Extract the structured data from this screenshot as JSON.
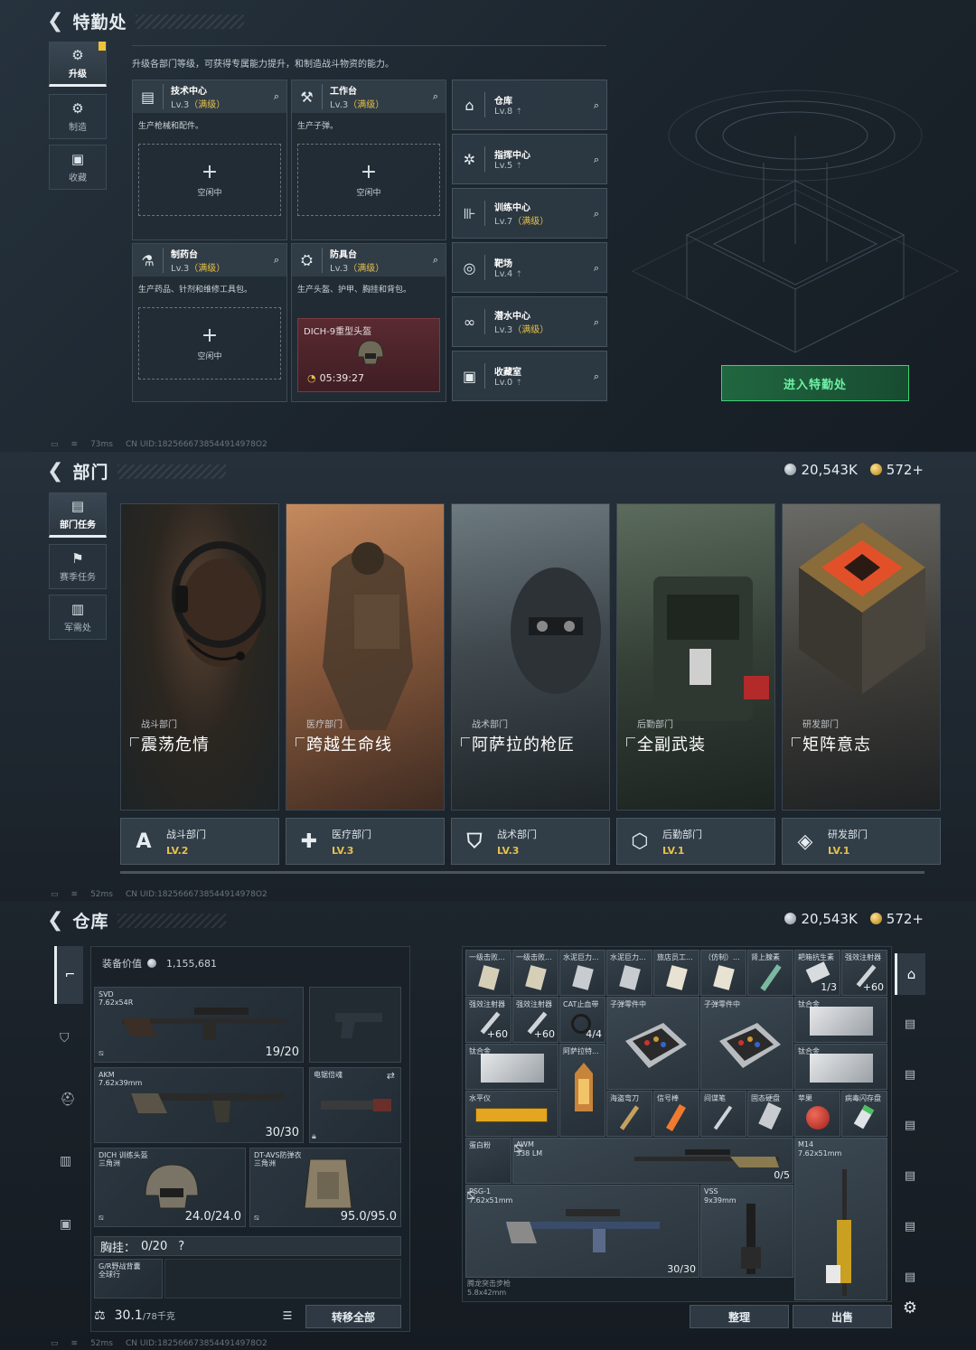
{
  "s1": {
    "title": "特勤处",
    "subtitle": "升级各部门等级，可获得专属能力提升，和制造战斗物资的能力。",
    "tabs": [
      {
        "label": "升级",
        "icon": "upgrade-icon"
      },
      {
        "label": "制造",
        "icon": "gears-icon"
      },
      {
        "label": "收藏",
        "icon": "collection-icon"
      }
    ],
    "workbenches": {
      "tech": {
        "name": "技术中心",
        "lv": "Lv.3",
        "max": "（满级）",
        "desc": "生产枪械和配件。",
        "slot": "空闲中"
      },
      "work": {
        "name": "工作台",
        "lv": "Lv.3",
        "max": "（满级）",
        "desc": "生产子弹。",
        "slot": "空闲中"
      },
      "pharm": {
        "name": "制药台",
        "lv": "Lv.3",
        "max": "（满级）",
        "desc": "生产药品、针剂和维修工具包。",
        "slot": "空闲中"
      },
      "armor": {
        "name": "防具台",
        "lv": "Lv.3",
        "max": "（满级）",
        "desc": "生产头盔、护甲、胸挂和背包。",
        "item": "DICH-9重型头盔",
        "timer": "05:39:27"
      }
    },
    "departments": [
      {
        "name": "仓库",
        "lv": "Lv.8",
        "max": "",
        "icon": "warehouse-icon"
      },
      {
        "name": "指挥中心",
        "lv": "Lv.5",
        "max": "",
        "icon": "command-icon"
      },
      {
        "name": "训练中心",
        "lv": "Lv.7",
        "max": "（满级）",
        "icon": "dumbbell-icon"
      },
      {
        "name": "靶场",
        "lv": "Lv.4",
        "max": "",
        "icon": "target-icon"
      },
      {
        "name": "潜水中心",
        "lv": "Lv.3",
        "max": "（满级）",
        "icon": "diving-icon"
      },
      {
        "name": "收藏室",
        "lv": "Lv.0",
        "max": "",
        "icon": "vault-icon"
      }
    ],
    "enter_btn": "进入特勤处",
    "status": {
      "ping": "73ms",
      "uid": "CN UID:1825666738544914978O2"
    }
  },
  "s2": {
    "title": "部门",
    "currency": {
      "silver": "20,543K",
      "gold": "572+"
    },
    "tabs": [
      {
        "label": "部门任务"
      },
      {
        "label": "赛季任务"
      },
      {
        "label": "军需处"
      }
    ],
    "posters": [
      {
        "cat": "战斗部门",
        "title": "震荡危情"
      },
      {
        "cat": "医疗部门",
        "title": "跨越生命线"
      },
      {
        "cat": "战术部门",
        "title": "阿萨拉的枪匠"
      },
      {
        "cat": "后勤部门",
        "title": "全副武装"
      },
      {
        "cat": "研发部门",
        "title": "矩阵意志"
      }
    ],
    "dept_cards": [
      {
        "name": "战斗部门",
        "lv": "LV.2",
        "icon": "combat-icon",
        "glyph": "A"
      },
      {
        "name": "医疗部门",
        "lv": "LV.3",
        "icon": "medical-cross-icon",
        "glyph": "✚"
      },
      {
        "name": "战术部门",
        "lv": "LV.3",
        "icon": "shield-icon",
        "glyph": "⛉"
      },
      {
        "name": "后勤部门",
        "lv": "LV.1",
        "icon": "logistics-icon",
        "glyph": "⬡"
      },
      {
        "name": "研发部门",
        "lv": "LV.1",
        "icon": "research-icon",
        "glyph": "◈"
      }
    ],
    "status": {
      "ping": "52ms",
      "uid": "CN UID:1825666738544914978O2"
    }
  },
  "s3": {
    "title": "仓库",
    "currency": {
      "silver": "20,543K",
      "gold": "572+"
    },
    "equip_label": "装备价值",
    "equip_value": "1,155,681",
    "gear": {
      "svd": {
        "name": "SVD",
        "ammo": "7.62x54R",
        "count": "19/20"
      },
      "akm": {
        "name": "AKM",
        "ammo": "7.62x39mm",
        "count": "30/30"
      },
      "saw": {
        "name": "电锯倍魂"
      },
      "helmet": {
        "name": "DICH 训练头盔",
        "sub": "三角洲",
        "count": "24.0/24.0"
      },
      "armor": {
        "name": "DT-AVS防弹衣",
        "sub": "三角洲",
        "count": "95.0/95.0"
      },
      "rig_label": "胸挂：",
      "rig_count": "0/20",
      "rig_q": "?",
      "bag": {
        "name": "G/R野战背囊",
        "sub": "全球行"
      }
    },
    "weight": "30.1",
    "weight_max": "/78千克",
    "transfer_btn": "转移全部",
    "inventory": {
      "row1": [
        {
          "name": "一级击败..."
        },
        {
          "name": "一级击败..."
        },
        {
          "name": "水泥巨力..."
        },
        {
          "name": "水泥巨力..."
        },
        {
          "name": "旅店员工..."
        },
        {
          "name": "（仿制）..."
        },
        {
          "name": "肾上腺素"
        },
        {
          "name": "耙箱抗生素",
          "qty": "1/3"
        },
        {
          "name": "强效注射器",
          "qty": "+60"
        }
      ],
      "row2": [
        {
          "name": "强效注射器",
          "qty": "+60"
        },
        {
          "name": "强效注射器",
          "qty": "+60"
        },
        {
          "name": "CAT止血带",
          "qty": "4/4"
        },
        {
          "name": "子弹零件中"
        },
        {
          "name": "子弹零件中"
        },
        {
          "name": "钛合金"
        }
      ],
      "row3": [
        {
          "name": "钛合金"
        },
        {
          "name": "阿萨拉特..."
        },
        {
          "name": "钛合金"
        }
      ],
      "row4": [
        {
          "name": "水平仪"
        },
        {
          "name": "海盗弯刀"
        },
        {
          "name": "信号棒"
        },
        {
          "name": "间谍笔"
        },
        {
          "name": "固态硬盘"
        },
        {
          "name": "苹果"
        },
        {
          "name": "病毒闪存盘"
        }
      ],
      "awm": {
        "name": "AWM",
        "ammo": "338 LM",
        "count": "0/5"
      },
      "egg": {
        "name": "蛋白粉"
      },
      "m14": {
        "name": "M14",
        "ammo": "7.62x51mm"
      },
      "psg": {
        "name": "PSG-1",
        "ammo": "7.62x51mm",
        "count": "30/30"
      },
      "vss": {
        "name": "VSS",
        "ammo": "9x39mm"
      },
      "rifle": {
        "name": "腾龙突击步枪",
        "ammo": "5.8x42mm"
      }
    },
    "sort_btn": "整理",
    "sell_btn": "出售",
    "status": {
      "ping": "52ms",
      "uid": "CN UID:1825666738544914978O2"
    }
  }
}
